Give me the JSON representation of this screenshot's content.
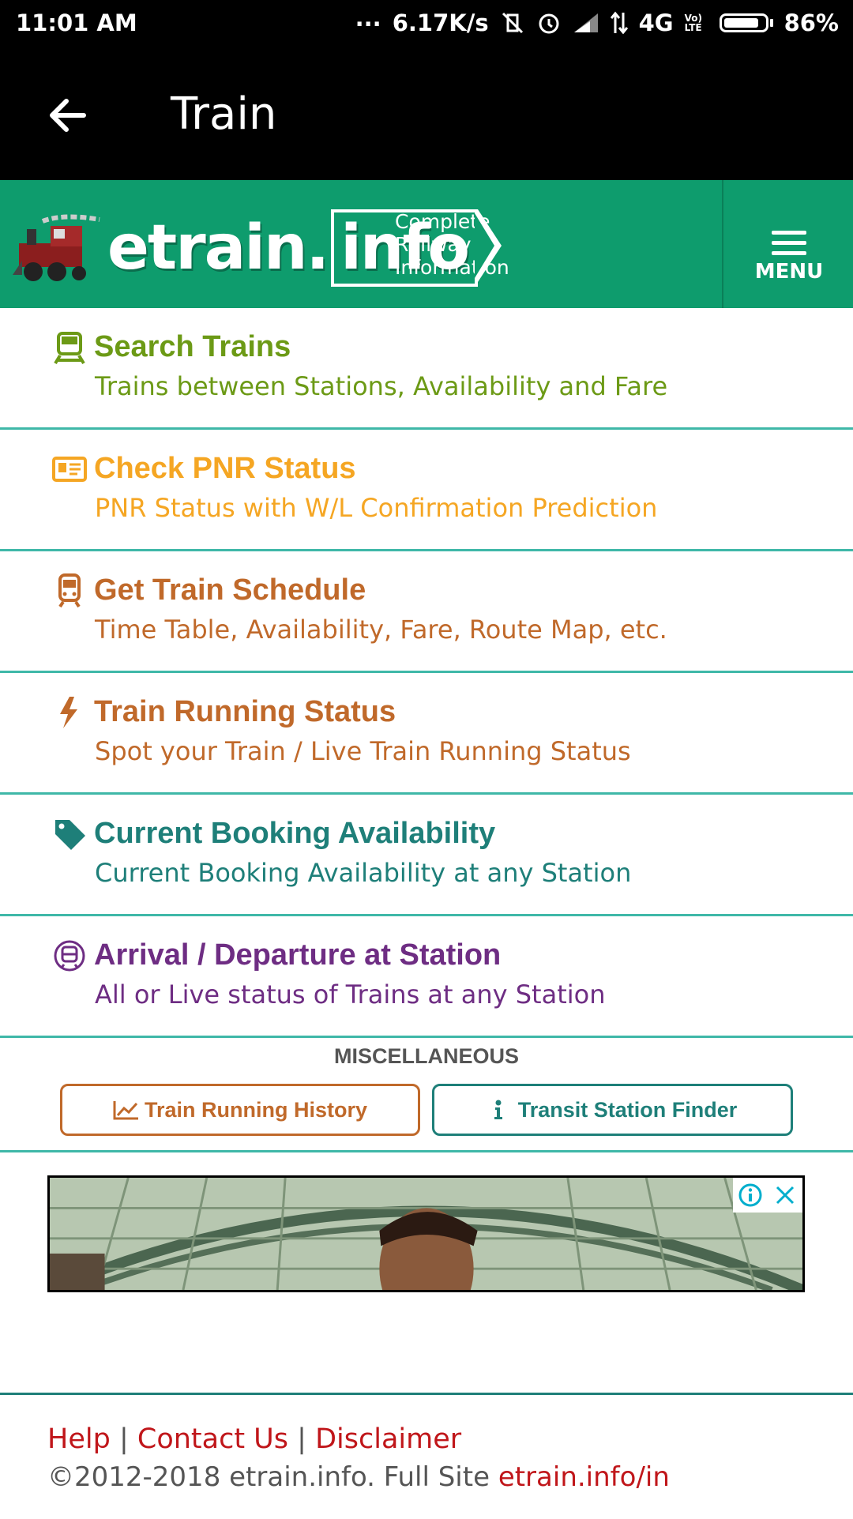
{
  "status_bar": {
    "time": "11:01 AM",
    "dots": "...",
    "speed": "6.17K/s",
    "network": "4G",
    "volte": "Vo) LTE",
    "battery_text": "86%",
    "battery_level": 0.86
  },
  "app_bar": {
    "title": "Train",
    "back_icon": "arrow-left-icon"
  },
  "site_header": {
    "logo_text_a": "etrain.",
    "logo_text_b": "info",
    "tagline_1": "Complete",
    "tagline_2": "Railway",
    "tagline_3": "Information",
    "menu_label": "MENU",
    "bg_color": "#0e9c6d"
  },
  "menu_items": [
    {
      "title": "Search Trains",
      "subtitle": "Trains between Stations, Availability and Fare",
      "icon": "train-front-icon",
      "color": "#6c9a16"
    },
    {
      "title": "Check PNR Status",
      "subtitle": "PNR Status with W/L Confirmation Prediction",
      "icon": "id-card-icon",
      "color": "#f5a623"
    },
    {
      "title": "Get Train Schedule",
      "subtitle": "Time Table, Availability, Fare, Route Map, etc.",
      "icon": "train-icon",
      "color": "#c0692a"
    },
    {
      "title": "Train Running Status",
      "subtitle": "Spot your Train / Live Train Running Status",
      "icon": "bolt-icon",
      "color": "#c0692a"
    },
    {
      "title": "Current Booking Availability",
      "subtitle": "Current Booking Availability at any Station",
      "icon": "tag-icon",
      "color": "#1e7f79"
    },
    {
      "title": "Arrival / Departure at Station",
      "subtitle": "All or Live status of Trains at any Station",
      "icon": "subway-icon",
      "color": "#6e2d83"
    }
  ],
  "misc": {
    "heading": "MISCELLANEOUS",
    "history_label": "Train Running History",
    "transit_label": "Transit Station Finder"
  },
  "footer": {
    "help": "Help",
    "sep": "|",
    "contact": "Contact Us",
    "disclaimer": "Disclaimer",
    "copyright": "©2012-2018 etrain.info. Full Site ",
    "full_site_link": "etrain.info/in"
  }
}
